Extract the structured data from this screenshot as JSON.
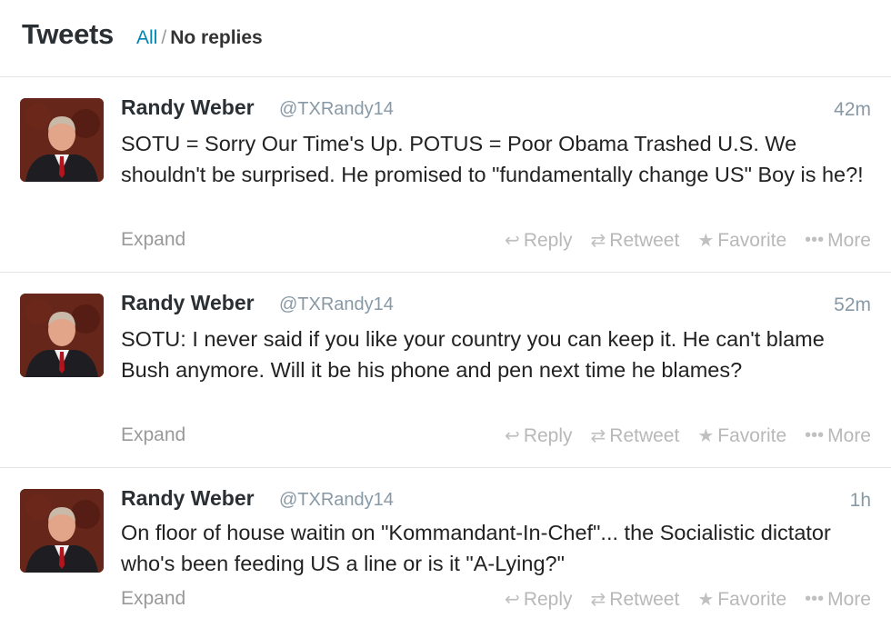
{
  "header": {
    "title": "Tweets",
    "filter_all": "All",
    "filter_sep": "/",
    "filter_noreplies": "No replies"
  },
  "actions": {
    "expand": "Expand",
    "reply": "Reply",
    "retweet": "Retweet",
    "favorite": "Favorite",
    "more": "More",
    "reply_icon": "↩",
    "retweet_icon": "⇄",
    "favorite_icon": "★",
    "more_icon": "•••"
  },
  "tweets": [
    {
      "name": "Randy Weber",
      "handle": "@TXRandy14",
      "time": "42m",
      "text": "SOTU = Sorry Our Time's Up. POTUS = Poor Obama Trashed U.S. We shouldn't be surprised. He promised to \"fundamentally change US\" Boy is he?!"
    },
    {
      "name": "Randy Weber",
      "handle": "@TXRandy14",
      "time": "52m",
      "text": "SOTU: I never said if you like your country you can keep it. He can't blame Bush anymore. Will it be his phone and pen next time he blames?"
    },
    {
      "name": "Randy Weber",
      "handle": "@TXRandy14",
      "time": "1h",
      "text": "On floor of house waitin on \"Kommandant-In-Chef\"... the Socialistic dictator who's been feeding US a line or is it \"A-Lying?\""
    }
  ],
  "colors": {
    "link": "#0084b4",
    "muted": "#8899a6",
    "action": "#b8b8b8"
  }
}
